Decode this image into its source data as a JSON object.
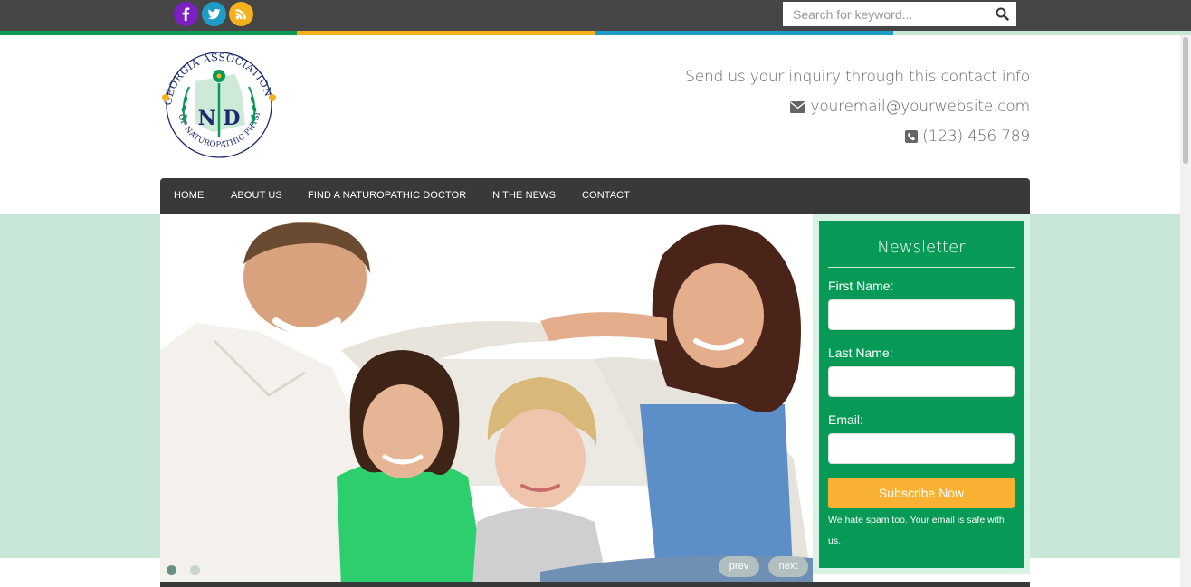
{
  "topbar": {
    "social": [
      {
        "name": "facebook-icon",
        "color": "#7b1fc4",
        "glyph": "f"
      },
      {
        "name": "twitter-icon",
        "color": "#1c9cc7",
        "glyph": "t"
      },
      {
        "name": "rss-icon",
        "color": "#f5b01b",
        "glyph": "rss"
      }
    ],
    "search": {
      "placeholder": "Search for keyword..."
    },
    "stripe_colors": [
      "#079a57",
      "#f5b01b",
      "#1c9cc7",
      "#c8e6d5"
    ]
  },
  "header": {
    "logo_text": "GEORGIA ASSOCIATION OF NATUROPATHIC PHYSICIANS",
    "logo_mark": "N D",
    "contact": {
      "intro": "Send us your inquiry through this contact info",
      "email": "youremail@yourwebsite.com",
      "phone": "(123) 456 789"
    }
  },
  "nav": {
    "items": [
      "HOME",
      "ABOUT US",
      "FIND A NATUROPATHIC DOCTOR",
      "IN THE NEWS",
      "CONTACT"
    ]
  },
  "slider": {
    "prev": "prev",
    "next": "next",
    "dots": 2,
    "active_dot": 0
  },
  "newsletter": {
    "title": "Newsletter",
    "first_name_label": "First Name:",
    "last_name_label": "Last Name:",
    "email_label": "Email:",
    "first_name_value": "",
    "last_name_value": "",
    "email_value": "",
    "button": "Subscribe Now",
    "note": "We hate spam too. Your email is safe with us."
  },
  "colors": {
    "brand_green": "#079a57",
    "accent_orange": "#f8b133",
    "nav_dark": "#393939",
    "mint": "#c8e6d5"
  }
}
